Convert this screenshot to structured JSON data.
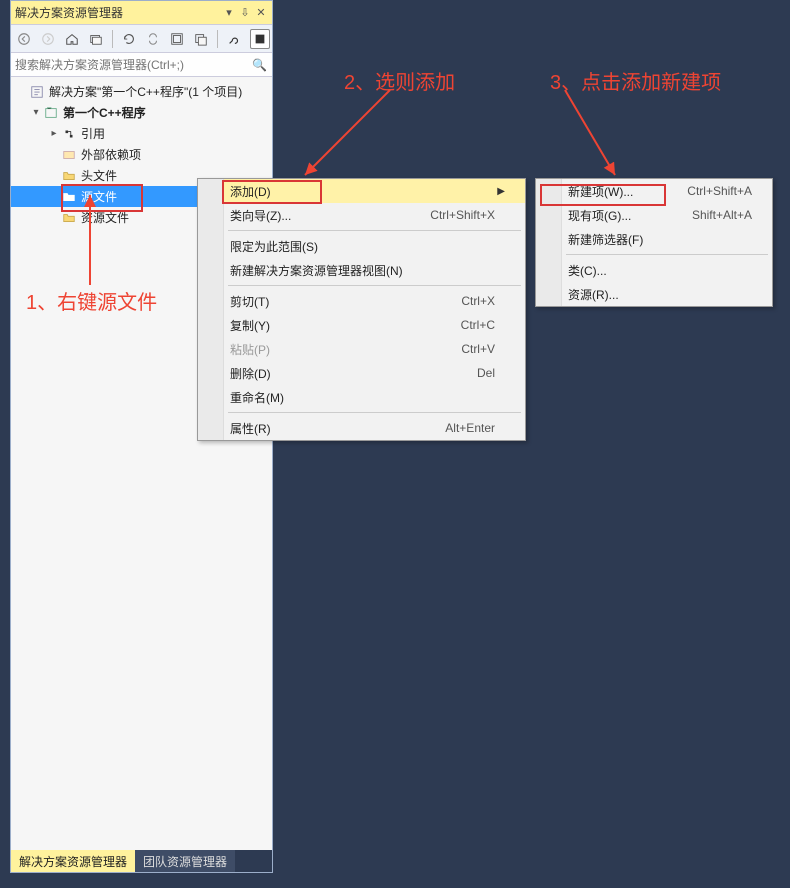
{
  "panel": {
    "title": "解决方案资源管理器",
    "search_placeholder": "搜索解决方案资源管理器(Ctrl+;)"
  },
  "tree": {
    "solution": "解决方案\"第一个C++程序\"(1 个项目)",
    "project": "第一个C++程序",
    "references": "引用",
    "external": "外部依赖项",
    "headers": "头文件",
    "sources": "源文件",
    "resources": "资源文件"
  },
  "menu1": {
    "add": "添加(D)",
    "wizard": "类向导(Z)...",
    "wizard_sc": "Ctrl+Shift+X",
    "scope": "限定为此范围(S)",
    "newview": "新建解决方案资源管理器视图(N)",
    "cut": "剪切(T)",
    "cut_sc": "Ctrl+X",
    "copy": "复制(Y)",
    "copy_sc": "Ctrl+C",
    "paste": "粘贴(P)",
    "paste_sc": "Ctrl+V",
    "delete": "删除(D)",
    "delete_sc": "Del",
    "rename": "重命名(M)",
    "props": "属性(R)",
    "props_sc": "Alt+Enter"
  },
  "menu2": {
    "new": "新建项(W)...",
    "new_sc": "Ctrl+Shift+A",
    "existing": "现有项(G)...",
    "existing_sc": "Shift+Alt+A",
    "filter": "新建筛选器(F)",
    "class": "类(C)...",
    "resource": "资源(R)..."
  },
  "tabs": {
    "active": "解决方案资源管理器",
    "other": "团队资源管理器"
  },
  "annotations": {
    "a1": "1、右键源文件",
    "a2": "2、选则添加",
    "a3": "3、点击添加新建项"
  }
}
